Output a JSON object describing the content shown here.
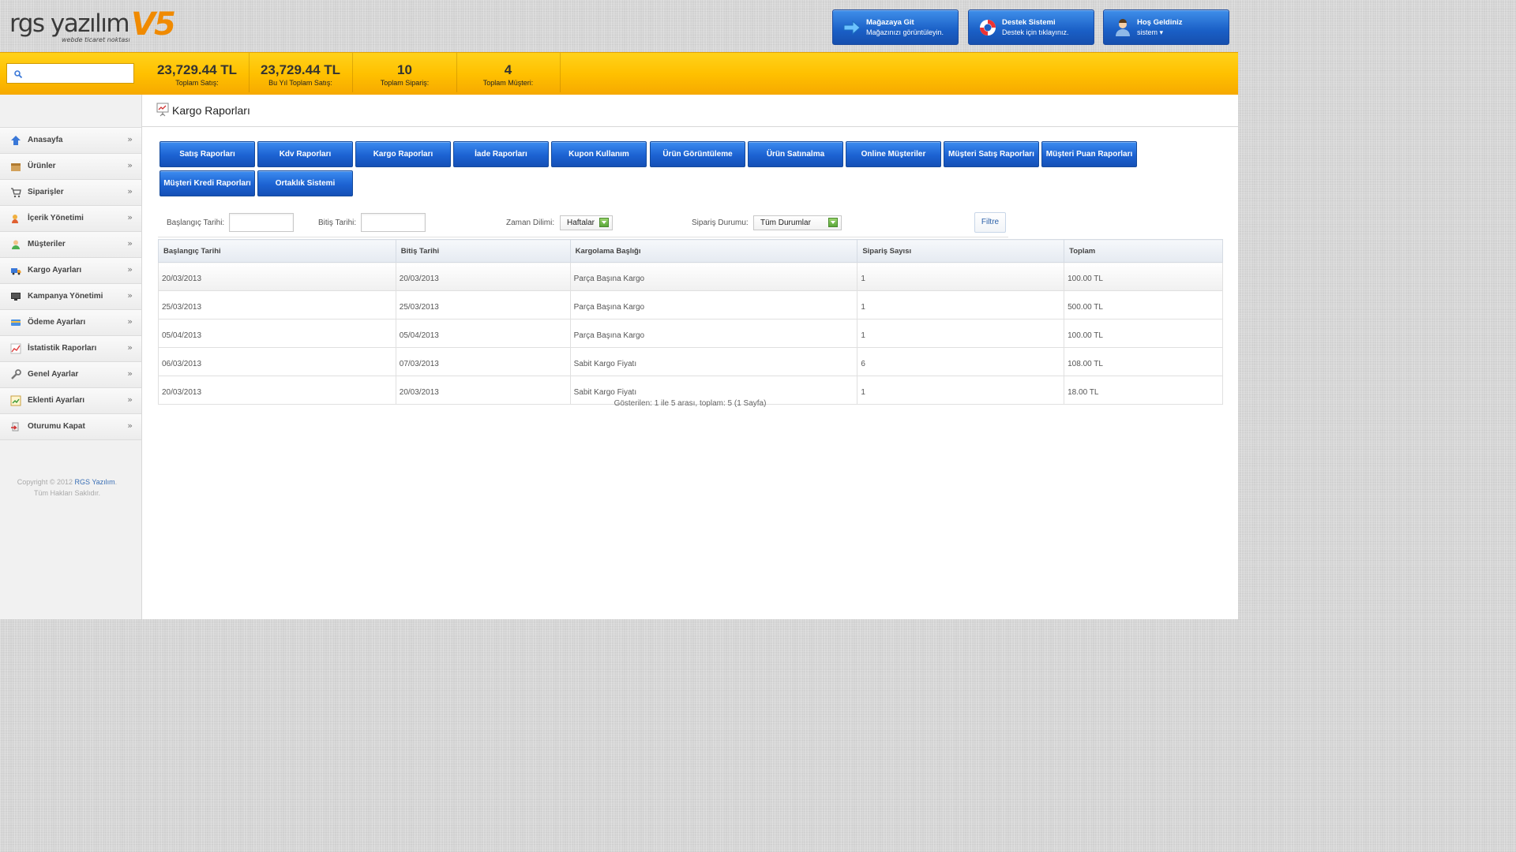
{
  "logo": {
    "brand": "rgs yazılım",
    "version": "V5",
    "tagline": "webde ticaret noktası"
  },
  "header_buttons": [
    {
      "title": "Mağazaya Git",
      "subtitle": "Mağazınızı görüntüleyin.",
      "icon": "arrow-right-icon"
    },
    {
      "title": "Destek Sistemi",
      "subtitle": "Destek için tıklayınız.",
      "icon": "lifebuoy-icon"
    },
    {
      "title": "Hoş Geldiniz",
      "subtitle": "sistem ▾",
      "icon": "user-icon"
    }
  ],
  "search": {
    "placeholder": "",
    "value": ""
  },
  "stats": [
    {
      "value": "23,729.44 TL",
      "label": "Toplam Satış:"
    },
    {
      "value": "23,729.44 TL",
      "label": "Bu Yıl Toplam Satış:"
    },
    {
      "value": "10",
      "label": "Toplam Sipariş:"
    },
    {
      "value": "4",
      "label": "Toplam Müşteri:"
    }
  ],
  "sidebar": {
    "items": [
      {
        "label": "Anasayfa",
        "icon": "home-icon"
      },
      {
        "label": "Ürünler",
        "icon": "box-icon"
      },
      {
        "label": "Siparişler",
        "icon": "cart-icon"
      },
      {
        "label": "İçerik Yönetimi",
        "icon": "content-icon"
      },
      {
        "label": "Müşteriler",
        "icon": "customers-icon"
      },
      {
        "label": "Kargo Ayarları",
        "icon": "truck-icon"
      },
      {
        "label": "Kampanya Yönetimi",
        "icon": "monitor-icon"
      },
      {
        "label": "Ödeme Ayarları",
        "icon": "credit-card-icon"
      },
      {
        "label": "İstatistik Raporları",
        "icon": "stats-icon"
      },
      {
        "label": "Genel Ayarlar",
        "icon": "wrench-icon"
      },
      {
        "label": "Eklenti Ayarları",
        "icon": "plugin-icon"
      },
      {
        "label": "Oturumu Kapat",
        "icon": "logout-icon"
      }
    ],
    "chevron": "»",
    "copyright_prefix": "Copyright © 2012",
    "copyright_brand": "RGS Yazılım",
    "copyright_suffix": ".",
    "copyright_line2": "Tüm Hakları Saklıdır."
  },
  "page": {
    "title": "Kargo Raporları",
    "icon": "report-icon"
  },
  "report_tabs": [
    "Satış Raporları",
    "Kdv Raporları",
    "Kargo Raporları",
    "İade Raporları",
    "Kupon Kullanım",
    "Ürün Görüntüleme",
    "Ürün Satınalma",
    "Online Müşteriler",
    "Müşteri Satış Raporları",
    "Müşteri Puan Raporları",
    "Müşteri Kredi Raporları",
    "Ortaklık Sistemi"
  ],
  "filters": {
    "start_label": "Başlangıç Tarihi:",
    "end_label": "Bitiş Tarihi:",
    "period_label": "Zaman Dilimi:",
    "period_value": "Haftalar",
    "status_label": "Sipariş Durumu:",
    "status_value": "Tüm Durumlar",
    "filter_button": "Filtre"
  },
  "table": {
    "headers": [
      "Başlangıç Tarihi",
      "Bitiş Tarihi",
      "Kargolama Başlığı",
      "Sipariş Sayısı",
      "Toplam"
    ],
    "rows": [
      [
        "20/03/2013",
        "20/03/2013",
        "Parça Başına Kargo",
        "1",
        "100.00 TL"
      ],
      [
        "25/03/2013",
        "25/03/2013",
        "Parça Başına Kargo",
        "1",
        "500.00 TL"
      ],
      [
        "05/04/2013",
        "05/04/2013",
        "Parça Başına Kargo",
        "1",
        "100.00 TL"
      ],
      [
        "06/03/2013",
        "07/03/2013",
        "Sabit Kargo Fiyatı",
        "6",
        "108.00 TL"
      ],
      [
        "20/03/2013",
        "20/03/2013",
        "Sabit Kargo Fiyatı",
        "1",
        "18.00 TL"
      ]
    ]
  },
  "pagination": {
    "text": "Gösterilen: 1 ile 5 arası, toplam: 5 (1 Sayfa)"
  },
  "colors": {
    "accent_blue": "#1c62d2",
    "stats_bar": "#ffc000",
    "logo_orange": "#f08a00"
  }
}
